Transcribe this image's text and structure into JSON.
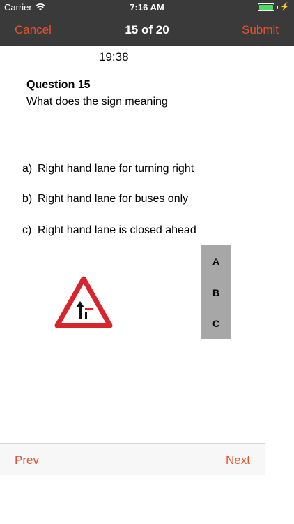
{
  "status": {
    "carrier": "Carrier",
    "time": "7:16 AM",
    "wifi_icon": "wifi-icon",
    "battery_icon": "battery-icon"
  },
  "nav": {
    "cancel": "Cancel",
    "title": "15 of 20",
    "submit": "Submit"
  },
  "quiz": {
    "timer": "19:38",
    "question_title": "Question 15",
    "question_text": "What does the sign meaning",
    "options": [
      {
        "letter": "a)",
        "text": "Right hand lane for turning right"
      },
      {
        "letter": "b)",
        "text": "Right hand lane for buses only"
      },
      {
        "letter": "c)",
        "text": "Right hand lane is closed ahead"
      }
    ],
    "sign_icon": "lane-closed-warning-sign"
  },
  "answers": [
    "A",
    "B",
    "C"
  ],
  "footer": {
    "prev": "Prev",
    "next": "Next"
  },
  "colors": {
    "accent": "#e8522b",
    "bar": "#3a3a3a",
    "sign_red": "#d9232d",
    "battery": "#4cd964",
    "answer_panel": "#a7a7a7"
  }
}
